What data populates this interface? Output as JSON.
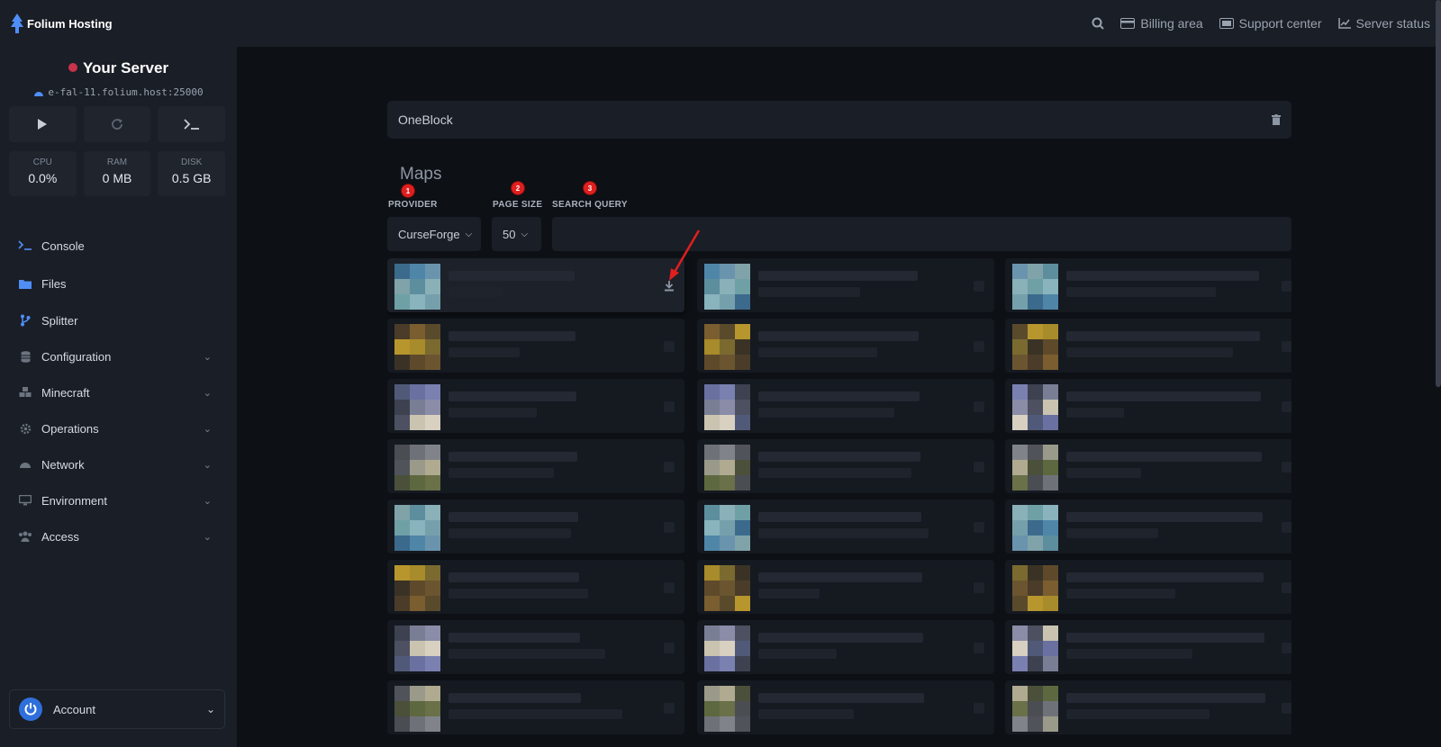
{
  "topbar": {
    "brand": "Folium Hosting",
    "links": [
      {
        "label": "",
        "icon": "search-icon"
      },
      {
        "label": "Billing area",
        "icon": "billing-icon"
      },
      {
        "label": "Support center",
        "icon": "support-icon"
      },
      {
        "label": "Server status",
        "icon": "chart-icon"
      }
    ]
  },
  "server": {
    "name": "Your Server",
    "status_color": "#c8324a",
    "host": "e-fal-11.folium.host:25000",
    "stats": [
      {
        "label": "CPU",
        "value": "0.0%"
      },
      {
        "label": "RAM",
        "value": "0 MB"
      },
      {
        "label": "DISK",
        "value": "0.5 GB"
      }
    ]
  },
  "sidebar": {
    "items": [
      {
        "label": "Console",
        "icon": "terminal-icon",
        "expandable": false
      },
      {
        "label": "Files",
        "icon": "folder-icon",
        "expandable": false
      },
      {
        "label": "Splitter",
        "icon": "branch-icon",
        "expandable": false
      },
      {
        "label": "Configuration",
        "icon": "database-icon",
        "expandable": true
      },
      {
        "label": "Minecraft",
        "icon": "cubes-icon",
        "expandable": true
      },
      {
        "label": "Operations",
        "icon": "gear-icon",
        "expandable": true
      },
      {
        "label": "Network",
        "icon": "network-icon",
        "expandable": true
      },
      {
        "label": "Environment",
        "icon": "monitor-icon",
        "expandable": true
      },
      {
        "label": "Access",
        "icon": "users-icon",
        "expandable": true
      }
    ],
    "account": {
      "label": "Account",
      "icon": "power-icon"
    }
  },
  "main": {
    "modpack_title": "OneBlock",
    "section_title": "Maps",
    "filters": {
      "provider": {
        "label": "PROVIDER",
        "value": "CurseForge",
        "badge": "1"
      },
      "page_size": {
        "label": "PAGE SIZE",
        "value": "50",
        "badge": "2"
      },
      "search": {
        "label": "SEARCH QUERY",
        "value": "",
        "placeholder": "",
        "badge": "3"
      }
    }
  },
  "colors": {
    "accent": "#2f6fdb",
    "badge": "#e01f1f",
    "background": "#0d1015",
    "panel": "#1a1e26"
  }
}
